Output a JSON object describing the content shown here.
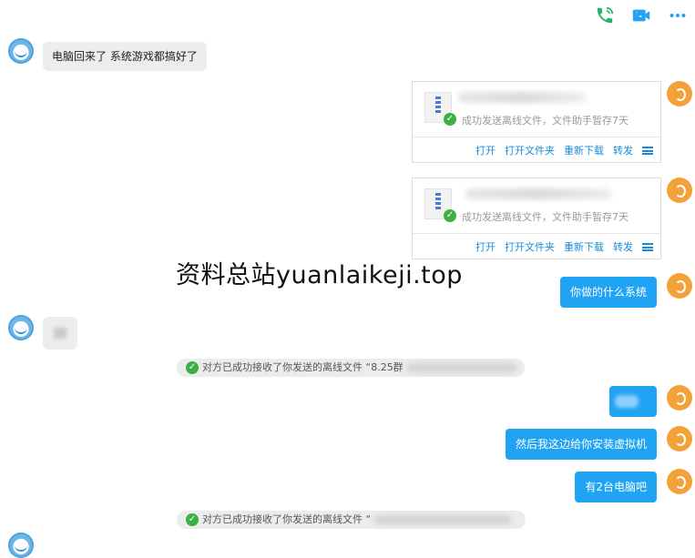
{
  "toolbar": {
    "icons": [
      "phone-icon",
      "video-call-icon",
      "more-icon"
    ],
    "colors": {
      "phone": "#1fb56a",
      "video": "#1fa3f2",
      "more": "#1fa3f2"
    }
  },
  "messages": {
    "peer_text_1": "电脑回来了 系统游戏都搞好了",
    "file_1": {
      "status": "成功发送离线文件，文件助手暂存7天",
      "actions": [
        "打开",
        "打开文件夹",
        "重新下载",
        "转发"
      ]
    },
    "file_2": {
      "status": "成功发送离线文件，文件助手暂存7天",
      "actions": [
        "打开",
        "打开文件夹",
        "重新下载",
        "转发"
      ]
    },
    "self_text_1": "你做的什么系统",
    "notice_1": "对方已成功接收了你发送的离线文件 “8.25群",
    "self_text_2": "然后我这边给你安装虚拟机",
    "self_text_3": "有2台电脑吧",
    "notice_2": "对方已成功接收了你发送的离线文件 “"
  },
  "watermark": "资料总站yuanlaikeji.top",
  "colors": {
    "bubble_self": "#1fa3f2",
    "bubble_peer": "#ededed",
    "link": "#1a8ad8",
    "success": "#3cb043"
  }
}
